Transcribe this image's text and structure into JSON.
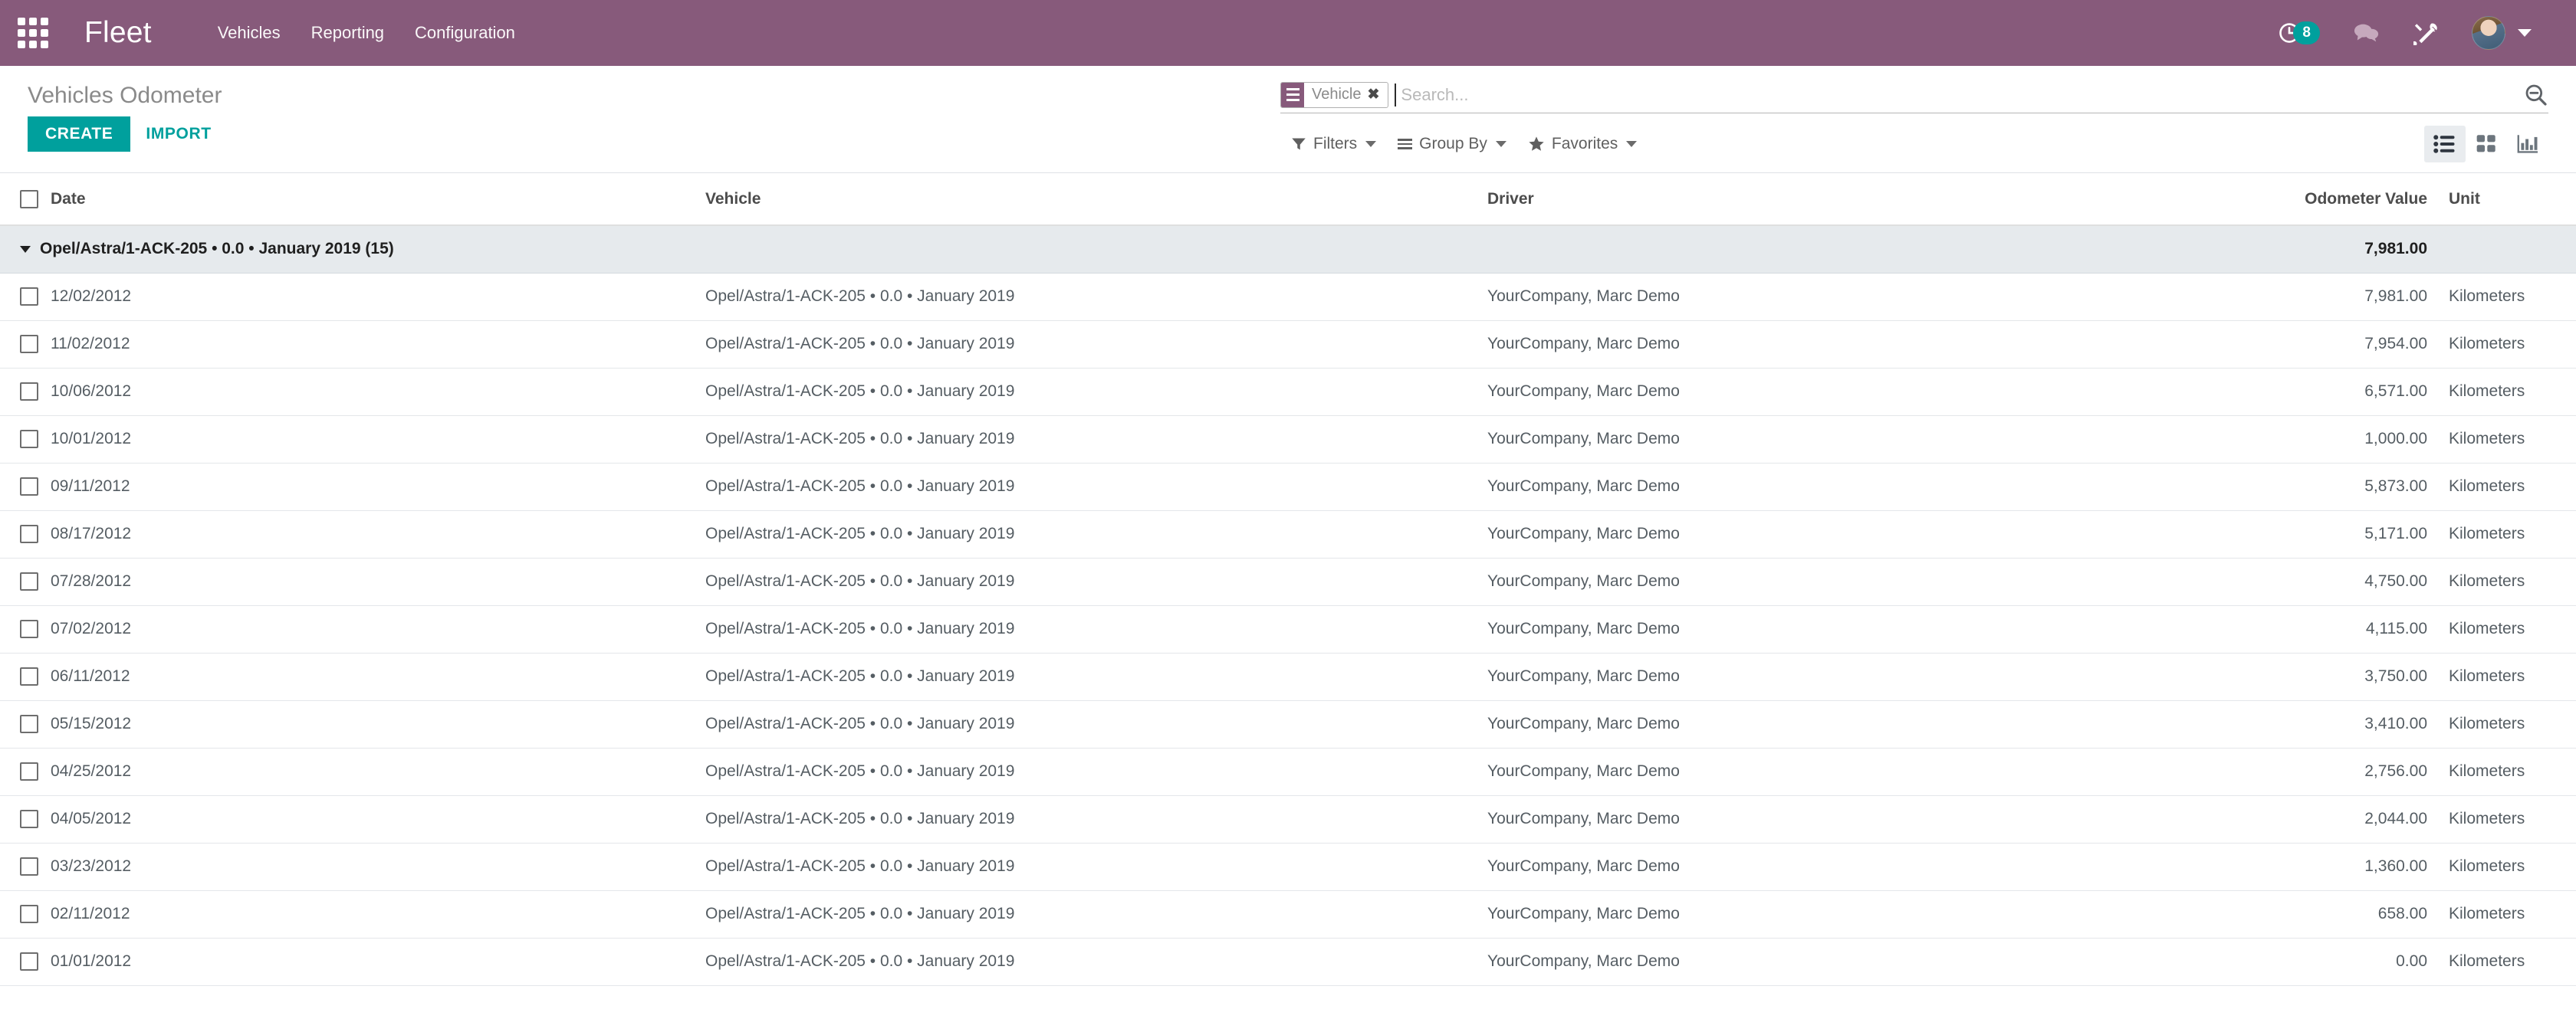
{
  "navbar": {
    "apps_icon": "apps-grid-icon",
    "brand": "Fleet",
    "menu": [
      {
        "label": "Vehicles"
      },
      {
        "label": "Reporting"
      },
      {
        "label": "Configuration"
      }
    ],
    "activity_icon": "clock-icon",
    "activity_count": "8",
    "messages_icon": "chat-bubble-icon",
    "debug_icon": "wrench-screwdriver-icon",
    "avatar": "user-avatar",
    "user_caret": "caret-down-icon",
    "colors": {
      "brand_purple": "#875A7B",
      "accent_teal": "#00A09D"
    }
  },
  "control_panel": {
    "title": "Vehicles Odometer",
    "create_label": "CREATE",
    "import_label": "IMPORT",
    "search": {
      "facet_icon": "group-by-lines-icon",
      "facet_label": "Vehicle",
      "facet_close": "✖",
      "placeholder": "Search...",
      "value": "",
      "magnifier_icon": "search-minus-icon"
    },
    "tools": [
      {
        "label": "Filters",
        "icon": "filter-funnel-icon"
      },
      {
        "label": "Group By",
        "icon": "group-by-lines-icon"
      },
      {
        "label": "Favorites",
        "icon": "star-icon"
      }
    ],
    "views": [
      {
        "name": "list-view",
        "icon": "list-icon",
        "active": true
      },
      {
        "name": "kanban-view",
        "icon": "kanban-icon",
        "active": false
      },
      {
        "name": "graph-view",
        "icon": "graph-icon",
        "active": false
      }
    ]
  },
  "table": {
    "columns": [
      "Date",
      "Vehicle",
      "Driver",
      "Odometer Value",
      "Unit"
    ],
    "group": {
      "label": "Opel/Astra/1-ACK-205 • 0.0 • January 2019 (15)",
      "total": "7,981.00"
    },
    "rows": [
      {
        "date": "12/02/2012",
        "vehicle": "Opel/Astra/1-ACK-205 • 0.0 • January 2019",
        "driver": "YourCompany, Marc Demo",
        "odometer": "7,981.00",
        "unit": "Kilometers"
      },
      {
        "date": "11/02/2012",
        "vehicle": "Opel/Astra/1-ACK-205 • 0.0 • January 2019",
        "driver": "YourCompany, Marc Demo",
        "odometer": "7,954.00",
        "unit": "Kilometers"
      },
      {
        "date": "10/06/2012",
        "vehicle": "Opel/Astra/1-ACK-205 • 0.0 • January 2019",
        "driver": "YourCompany, Marc Demo",
        "odometer": "6,571.00",
        "unit": "Kilometers"
      },
      {
        "date": "10/01/2012",
        "vehicle": "Opel/Astra/1-ACK-205 • 0.0 • January 2019",
        "driver": "YourCompany, Marc Demo",
        "odometer": "1,000.00",
        "unit": "Kilometers"
      },
      {
        "date": "09/11/2012",
        "vehicle": "Opel/Astra/1-ACK-205 • 0.0 • January 2019",
        "driver": "YourCompany, Marc Demo",
        "odometer": "5,873.00",
        "unit": "Kilometers"
      },
      {
        "date": "08/17/2012",
        "vehicle": "Opel/Astra/1-ACK-205 • 0.0 • January 2019",
        "driver": "YourCompany, Marc Demo",
        "odometer": "5,171.00",
        "unit": "Kilometers"
      },
      {
        "date": "07/28/2012",
        "vehicle": "Opel/Astra/1-ACK-205 • 0.0 • January 2019",
        "driver": "YourCompany, Marc Demo",
        "odometer": "4,750.00",
        "unit": "Kilometers"
      },
      {
        "date": "07/02/2012",
        "vehicle": "Opel/Astra/1-ACK-205 • 0.0 • January 2019",
        "driver": "YourCompany, Marc Demo",
        "odometer": "4,115.00",
        "unit": "Kilometers"
      },
      {
        "date": "06/11/2012",
        "vehicle": "Opel/Astra/1-ACK-205 • 0.0 • January 2019",
        "driver": "YourCompany, Marc Demo",
        "odometer": "3,750.00",
        "unit": "Kilometers"
      },
      {
        "date": "05/15/2012",
        "vehicle": "Opel/Astra/1-ACK-205 • 0.0 • January 2019",
        "driver": "YourCompany, Marc Demo",
        "odometer": "3,410.00",
        "unit": "Kilometers"
      },
      {
        "date": "04/25/2012",
        "vehicle": "Opel/Astra/1-ACK-205 • 0.0 • January 2019",
        "driver": "YourCompany, Marc Demo",
        "odometer": "2,756.00",
        "unit": "Kilometers"
      },
      {
        "date": "04/05/2012",
        "vehicle": "Opel/Astra/1-ACK-205 • 0.0 • January 2019",
        "driver": "YourCompany, Marc Demo",
        "odometer": "2,044.00",
        "unit": "Kilometers"
      },
      {
        "date": "03/23/2012",
        "vehicle": "Opel/Astra/1-ACK-205 • 0.0 • January 2019",
        "driver": "YourCompany, Marc Demo",
        "odometer": "1,360.00",
        "unit": "Kilometers"
      },
      {
        "date": "02/11/2012",
        "vehicle": "Opel/Astra/1-ACK-205 • 0.0 • January 2019",
        "driver": "YourCompany, Marc Demo",
        "odometer": "658.00",
        "unit": "Kilometers"
      },
      {
        "date": "01/01/2012",
        "vehicle": "Opel/Astra/1-ACK-205 • 0.0 • January 2019",
        "driver": "YourCompany, Marc Demo",
        "odometer": "0.00",
        "unit": "Kilometers"
      }
    ]
  }
}
